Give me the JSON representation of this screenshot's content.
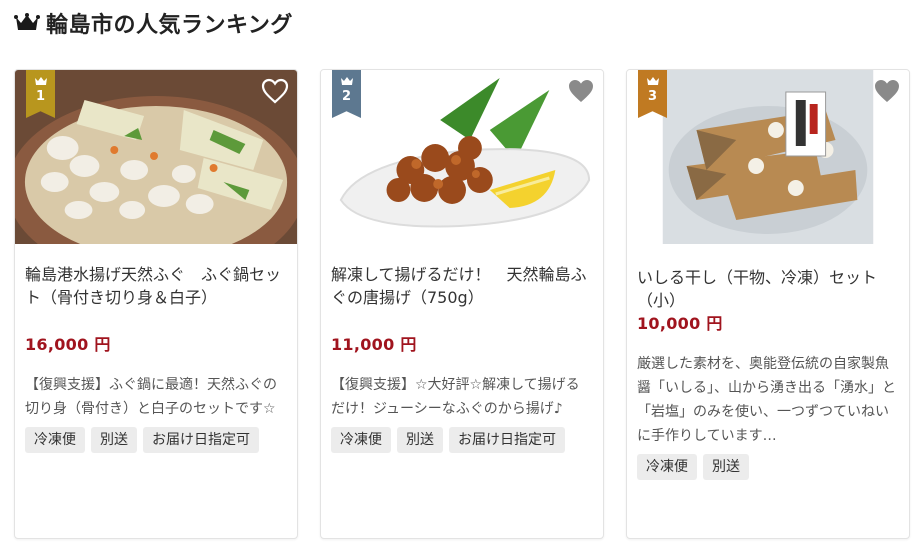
{
  "section": {
    "title": "輪島市の人気ランキング",
    "icon": "crown-icon"
  },
  "items": [
    {
      "rank": "1",
      "badge_color": "#b8961e",
      "title": "輪島港水揚げ天然ふぐ　ふぐ鍋セット（骨付き切り身＆白子）",
      "price": "16,000 円",
      "description": "【復興支援】ふぐ鍋に最適！天然ふぐの切り身（骨付き）と白子のセットです☆",
      "tags": [
        "冷凍便",
        "別送",
        "お届け日指定可"
      ],
      "favorite_icon": "heart-icon"
    },
    {
      "rank": "2",
      "badge_color": "#5d7890",
      "title": "解凍して揚げるだけ！　天然輪島ふぐの唐揚げ（750g）",
      "price": "11,000 円",
      "description": "【復興支援】☆大好評☆解凍して揚げるだけ！ジューシーなふぐのから揚げ♪",
      "tags": [
        "冷凍便",
        "別送",
        "お届け日指定可"
      ],
      "favorite_icon": "heart-icon"
    },
    {
      "rank": "3",
      "badge_color": "#c07a22",
      "title": "いしる干し（干物、冷凍）セット（小）",
      "price": "10,000 円",
      "description": "厳選した素材を、奥能登伝統の自家製魚醤「いしる」、山から湧き出る「湧水」と「岩塩」のみを使い、一つずつていねいに手作りしています…",
      "tags": [
        "冷凍便",
        "別送"
      ],
      "favorite_icon": "heart-icon"
    }
  ],
  "colors": {
    "price": "#a0141e",
    "tag_bg": "#ececec",
    "heading": "#222222"
  }
}
